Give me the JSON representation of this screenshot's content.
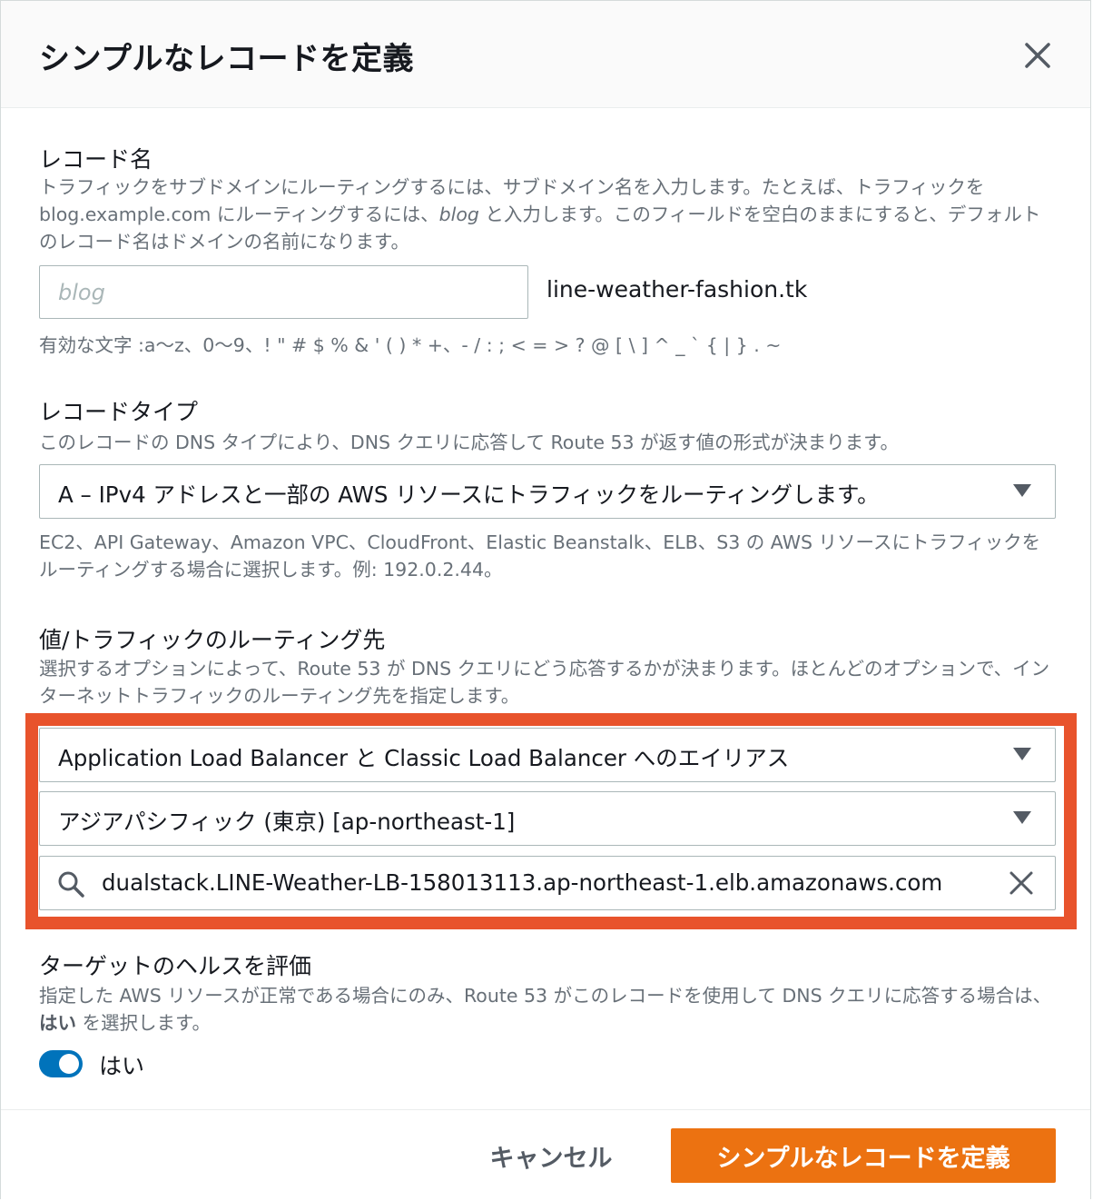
{
  "dialog": {
    "title": "シンプルなレコードを定義",
    "close_icon": "close-icon"
  },
  "record_name": {
    "label": "レコード名",
    "desc_part1": "トラフィックをサブドメインにルーティングするには、サブドメイン名を入力します。たとえば、トラフィックを blog.example.com にルーティングするには、",
    "desc_emphasis": "blog",
    "desc_part2": " と入力します。このフィールドを空白のままにすると、デフォルトのレコード名はドメインの名前になります。",
    "placeholder": "blog",
    "value": "",
    "domain_suffix": "line-weather-fashion.tk",
    "valid_chars": "有効な文字 :a〜z、0〜9、! \" # $ % & ' ( ) * +、- / : ; < = > ? @ [ \\ ] ^ _ ` { | } . ~"
  },
  "record_type": {
    "label": "レコードタイプ",
    "desc": "このレコードの DNS タイプにより、DNS クエリに応答して Route 53 が返す値の形式が決まります。",
    "selected": "A – IPv4 アドレスと一部の AWS リソースにトラフィックをルーティングします。",
    "hint": "EC2、API Gateway、Amazon VPC、CloudFront、Elastic Beanstalk、ELB、S3 の AWS リソースにトラフィックをルーティングする場合に選択します。例: 192.0.2.44。"
  },
  "route_target": {
    "label": "値/トラフィックのルーティング先",
    "desc": "選択するオプションによって、Route 53 が DNS クエリにどう応答するかが決まります。ほとんどのオプションで、インターネットトラフィックのルーティング先を指定します。",
    "endpoint_selected": "Application Load Balancer と Classic Load Balancer へのエイリアス",
    "region_selected": "アジアパシフィック (東京) [ap-northeast-1]",
    "load_balancer_value": "dualstack.LINE-Weather-LB-158013113.ap-northeast-1.elb.amazonaws.com",
    "highlight_color": "#e8532c"
  },
  "health": {
    "label": "ターゲットのヘルスを評価",
    "desc_part1": "指定した AWS リソースが正常である場合にのみ、Route 53 がこのレコードを使用して DNS クエリに応答する場合は、",
    "desc_emphasis": "はい",
    "desc_part2": " を選択します。",
    "toggle_label": "はい",
    "toggle_on": true
  },
  "footer": {
    "cancel_label": "キャンセル",
    "submit_label": "シンプルなレコードを定義",
    "submit_color": "#ec7211"
  }
}
